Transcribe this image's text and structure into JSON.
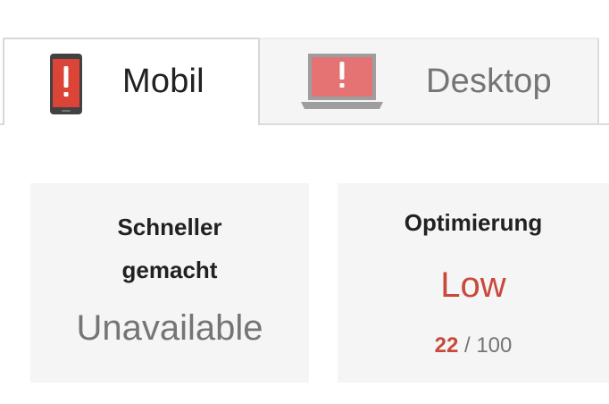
{
  "tabs": [
    {
      "label": "Mobil",
      "icon": "mobile-phone-warning-icon",
      "selected": true
    },
    {
      "label": "Desktop",
      "icon": "laptop-warning-icon",
      "selected": false
    }
  ],
  "cards": {
    "speed": {
      "title": "Schneller gemacht",
      "value": "Unavailable"
    },
    "optimization": {
      "title": "Optimierung",
      "value": "Low",
      "score": "22",
      "score_separator": "/",
      "score_max": "100"
    }
  },
  "colors": {
    "warning_red": "#db4437",
    "score_red": "#c9493c",
    "card_background": "#f5f5f5",
    "muted_text": "#757575"
  }
}
